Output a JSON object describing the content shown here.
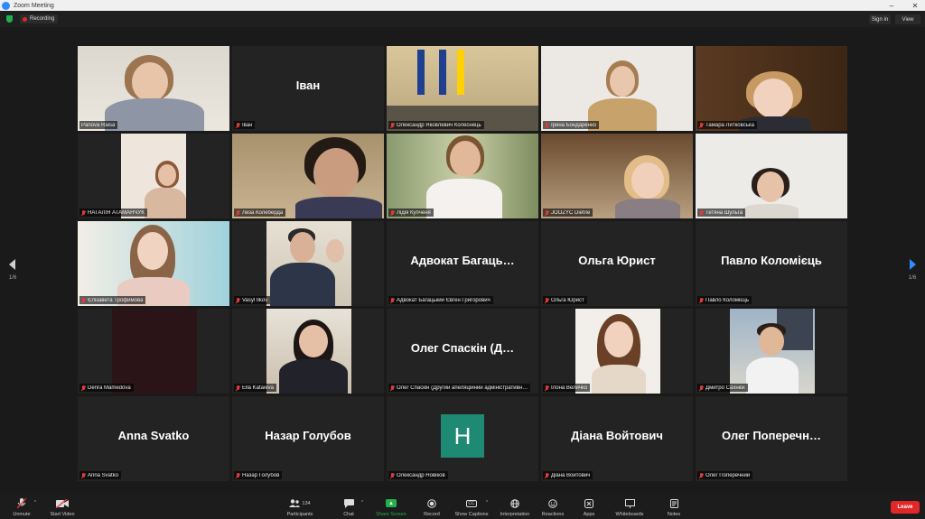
{
  "window": {
    "title": "Zoom Meeting",
    "minimize": "–",
    "restore": "□",
    "close": "✕"
  },
  "topbar": {
    "recording_label": "Recording",
    "sign_in_label": "Sign in",
    "view_label": "View"
  },
  "pager": {
    "left_indicator": "1/6",
    "right_indicator": "1/6"
  },
  "tiles": [
    {
      "name": "Panova Raisa",
      "video": true
    },
    {
      "name": "Іван",
      "display_name": "Іван",
      "video": false
    },
    {
      "name": "Олександр Яковлевич Колеснець",
      "video": true
    },
    {
      "name": "Ірина Бондаренко",
      "video": true
    },
    {
      "name": "Тамара Литковська",
      "video": true
    },
    {
      "name": "НАТАЛІЯ АТАМАНЧУК",
      "video": true
    },
    {
      "name": "Лиза Колеберда",
      "video": true
    },
    {
      "name": "Лідія Купченя",
      "video": true
    },
    {
      "name": "JOOZYC Dietrie",
      "video": true
    },
    {
      "name": "Тетяна Шульга",
      "video": true
    },
    {
      "name": "Єлізаветa Трофимова",
      "video": true
    },
    {
      "name": "Vasyl Ilkov",
      "video": true
    },
    {
      "name": "Адвокат Багацький Євген Григорович",
      "display_name": "Адвокат Багаць…",
      "video": false
    },
    {
      "name": "Ольга Юрист",
      "display_name": "Ольга Юрист",
      "video": false
    },
    {
      "name": "Павло Коломієць",
      "display_name": "Павло Коломієць",
      "video": false
    },
    {
      "name": "Derira Mamedova",
      "video": true
    },
    {
      "name": "Ella Kataieva",
      "video": true
    },
    {
      "name": "Олег Спаскін (Другий апеляційний адміністративн…",
      "display_name": "Олег Спаскін (Д…",
      "video": false
    },
    {
      "name": "Ілона Величко",
      "video": true
    },
    {
      "name": "Дмитро Сахнюк",
      "video": true
    },
    {
      "name": "Anna Svatko",
      "display_name": "Anna Svatko",
      "video": false
    },
    {
      "name": "Назар Голубов",
      "display_name": "Назар Голубов",
      "video": false
    },
    {
      "name": "Олександр Новіков",
      "avatar_letter": "H",
      "video": false
    },
    {
      "name": "Діана Войтович",
      "display_name": "Діана Войтович",
      "video": false
    },
    {
      "name": "Олег Поперечний",
      "display_name": "Олег Поперечн…",
      "video": false
    }
  ],
  "toolbar": {
    "unmute": "Unmute",
    "start_video": "Start Video",
    "participants": "Participants",
    "participants_count": "134",
    "chat": "Chat",
    "share_screen": "Share Screen",
    "record": "Record",
    "show_captions": "Show Captions",
    "cc_badge": "CC",
    "interpretation": "Interpretation",
    "reactions": "Reactions",
    "apps": "Apps",
    "whiteboards": "Whiteboards",
    "notes": "Notes",
    "leave": "Leave"
  },
  "colors": {
    "active_speaker_outline": "#c9e04c",
    "share_green": "#23b14d",
    "leave_red": "#e02828",
    "muted_red": "#e03b3b",
    "avatar_teal": "#1e8a73"
  }
}
